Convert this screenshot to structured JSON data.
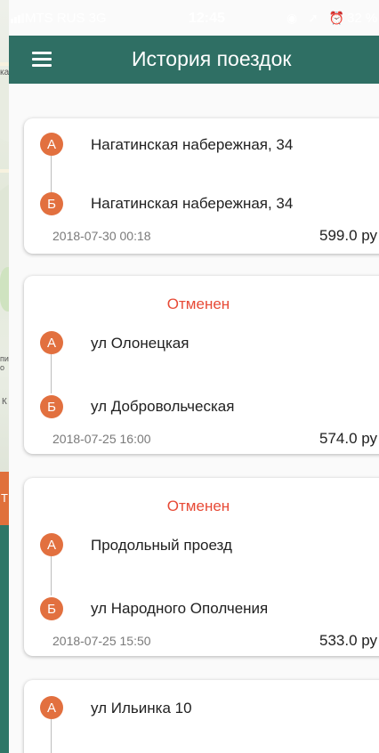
{
  "status_bar": {
    "carrier": "MTS RUS  3G",
    "time": "12:45",
    "icons": "◉ ➚ ⏰",
    "battery": "32 %"
  },
  "background": {
    "map_label_a": "ка",
    "map_label_b": "пи",
    "map_label_c": "о",
    "map_label_d": "К",
    "button_letter": "Т"
  },
  "app_bar": {
    "title": "История поездок",
    "menu_icon": "hamburger-menu-icon"
  },
  "trips": [
    {
      "status": "",
      "from_marker": "А",
      "from": "Нагатинская набережная, 34",
      "to_marker": "Б",
      "to": "Нагатинская набережная, 34",
      "date": "2018-07-30 00:18",
      "price": "599.0 ру"
    },
    {
      "status": "Отменен",
      "from_marker": "А",
      "from": "ул Олонецкая",
      "to_marker": "Б",
      "to": "ул Добровольческая",
      "date": "2018-07-25 16:00",
      "price": "574.0 ру"
    },
    {
      "status": "Отменен",
      "from_marker": "А",
      "from": "Продольный проезд",
      "to_marker": "Б",
      "to": "ул Народного Ополчения",
      "date": "2018-07-25 15:50",
      "price": "533.0 ру"
    },
    {
      "status": "",
      "from_marker": "А",
      "from": "ул Ильинка 10",
      "to_marker": "",
      "to": "",
      "date": "",
      "price": ""
    }
  ],
  "colors": {
    "app_bar": "#2f6f64",
    "marker": "#e2703f",
    "cancelled": "#e74a36"
  }
}
